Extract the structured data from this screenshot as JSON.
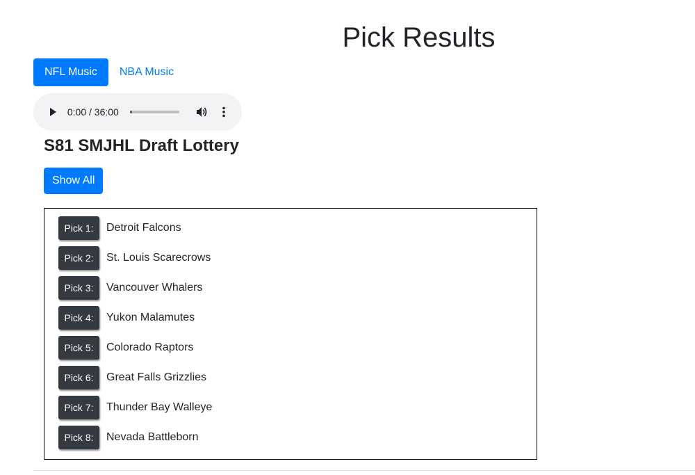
{
  "page": {
    "title": "Pick Results"
  },
  "tabs": [
    {
      "label": "NFL Music",
      "active": true
    },
    {
      "label": "NBA Music",
      "active": false
    }
  ],
  "audio": {
    "time": "0:00 / 36:00",
    "progress": 0.0
  },
  "lottery": {
    "title": "S81 SMJHL Draft Lottery",
    "show_all_label": "Show All"
  },
  "picks": [
    {
      "label": "Pick 1:",
      "team": "Detroit Falcons"
    },
    {
      "label": "Pick 2:",
      "team": "St. Louis Scarecrows"
    },
    {
      "label": "Pick 3:",
      "team": "Vancouver Whalers"
    },
    {
      "label": "Pick 4:",
      "team": "Yukon Malamutes"
    },
    {
      "label": "Pick 5:",
      "team": "Colorado Raptors"
    },
    {
      "label": "Pick 6:",
      "team": "Great Falls Grizzlies"
    },
    {
      "label": "Pick 7:",
      "team": "Thunder Bay Walleye"
    },
    {
      "label": "Pick 8:",
      "team": "Nevada Battleborn"
    }
  ],
  "colors": {
    "primary": "#007bff",
    "badge": "#343a40",
    "player_bg": "#f1f3f4"
  },
  "icons": {
    "play": "play-icon",
    "volume": "volume-icon",
    "menu": "more-vertical-icon"
  }
}
